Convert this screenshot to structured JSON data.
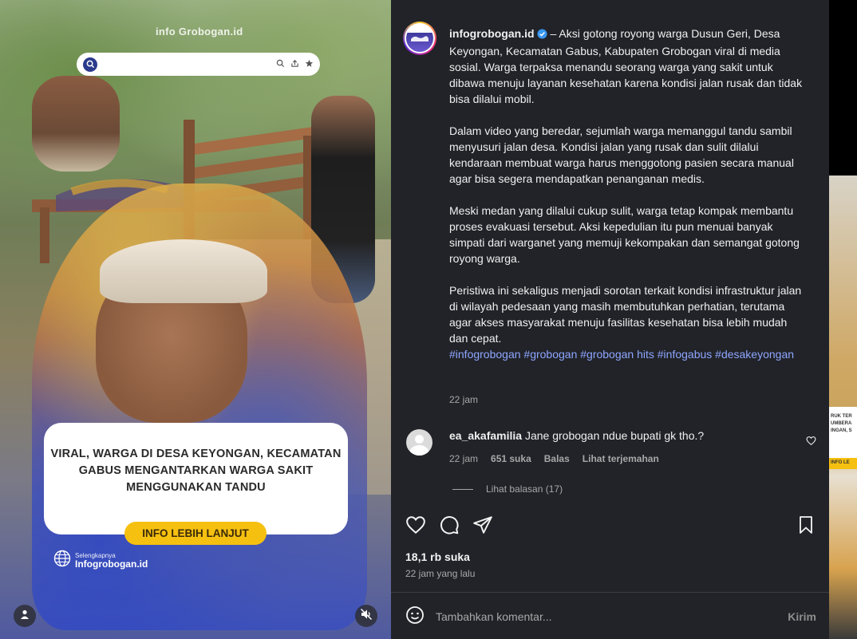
{
  "media": {
    "watermark": "info Grobogan.id",
    "card_text": "VIRAL, WARGA DI DESA KEYONGAN, KECAMATAN GABUS  MENGANTARKAN WARGA SAKIT MENGGUNAKAN TANDU",
    "card_button": "INFO LEBIH LANJUT",
    "brand_small": "Selengkapnya",
    "brand_big": "Infogrobogan.id",
    "icons": [
      "search-icon",
      "share-icon",
      "star-icon",
      "user-tag-icon",
      "mute-icon"
    ]
  },
  "post": {
    "username": "infogrobogan.id",
    "caption_first": "– Aksi gotong royong warga Dusun Geri, Desa Keyongan, Kecamatan Gabus, Kabupaten Grobogan viral di media sosial. Warga terpaksa menandu seorang warga yang sakit untuk dibawa menuju layanan kesehatan karena kondisi jalan rusak dan tidak bisa dilalui mobil.",
    "paragraphs": [
      "Dalam video yang beredar, sejumlah warga memanggul tandu sambil menyusuri jalan desa. Kondisi jalan yang rusak dan sulit dilalui kendaraan membuat warga harus menggotong pasien secara manual agar bisa segera mendapatkan penanganan medis.",
      "Meski medan yang dilalui cukup sulit, warga tetap kompak membantu proses evakuasi tersebut. Aksi kepedulian itu pun menuai banyak simpati dari warganet yang memuji kekompakan dan semangat gotong royong warga."
    ],
    "last_paragraph": "Peristiwa ini sekaligus menjadi sorotan terkait kondisi infrastruktur jalan di wilayah pedesaan yang masih membutuhkan perhatian, terutama agar akses masyarakat menuju fasilitas kesehatan bisa lebih mudah dan cepat.",
    "hashtags": "#infogrobogan #grobogan #grobogan hits #infogabus #desakeyongan",
    "time": "22 jam",
    "likes": "18,1 rb suka",
    "posted_ago": "22 jam yang lalu"
  },
  "comment": {
    "username": "ea_akafamilia",
    "text": "Jane grobogan ndue bupati gk tho.?",
    "time": "22 jam",
    "likes": "651 suka",
    "reply": "Balas",
    "translate": "Lihat terjemahan",
    "view_replies": "Lihat balasan (17)"
  },
  "composer": {
    "placeholder": "Tambahkan komentar...",
    "post_label": "Kirim"
  },
  "peek": {
    "card_text": "RUK TER UMBERA INGAN, S",
    "button": "INFO LE"
  },
  "colors": {
    "panel_bg": "#212328",
    "hashtag": "#8fa6ff",
    "verified": "#3897f0",
    "yellow_button": "#f5c010"
  }
}
